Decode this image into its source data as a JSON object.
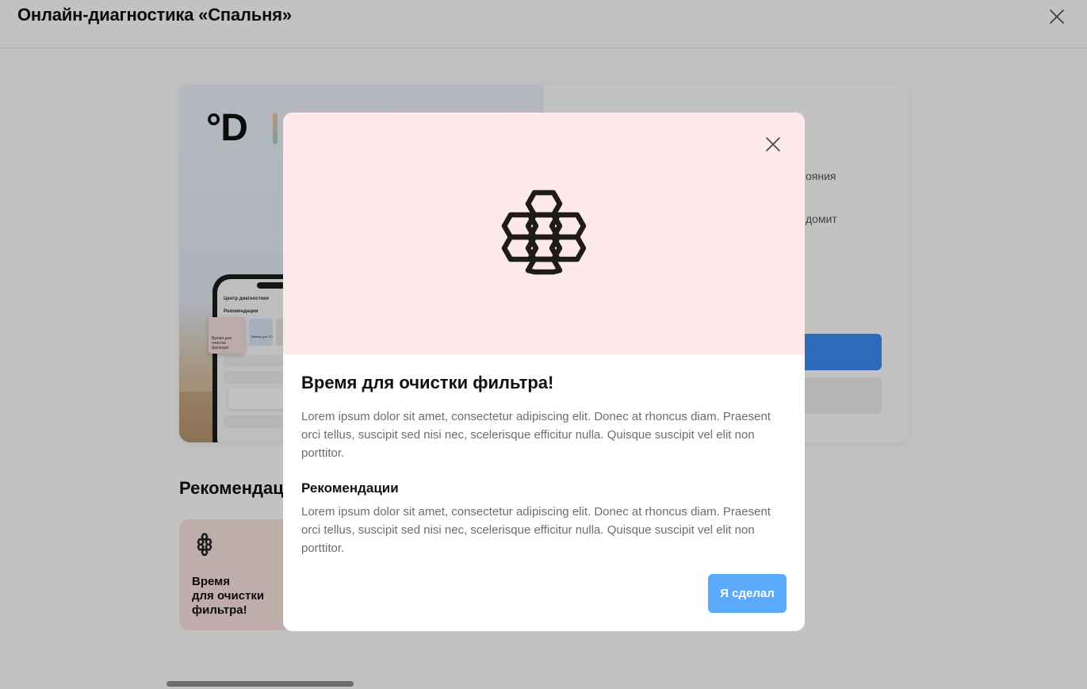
{
  "page": {
    "title": "Онлайн-диагностика «Спальня»",
    "close_icon": "close-icon",
    "brand": "°D",
    "hero_right_lines": [
      "ояния",
      "домит"
    ],
    "phone": {
      "header": "Центр диагностики",
      "section": "Рекомендации",
      "tile_label": "Время для очистки фильтра!",
      "tile2_label": "Время для ТО"
    },
    "recommendations_title": "Рекомендации",
    "rec_card": {
      "icon": "honeycomb-icon",
      "label": "Время\nдля очистки\nфильтра!"
    }
  },
  "modal": {
    "close_icon": "close-icon",
    "hero_icon": "honeycomb-icon",
    "title": "Время для очистки фильтра!",
    "description": "Lorem ipsum dolor sit amet, consectetur adipiscing elit. Donec at rhoncus diam. Praesent orci tellus, suscipit sed nisi nec, scelerisque efficitur nulla. Quisque suscipit vel elit non porttitor.",
    "recommendations_title": "Рекомендации",
    "recommendations_text": "Lorem ipsum dolor sit amet, consectetur adipiscing elit. Donec at rhoncus diam. Praesent orci tellus, suscipit sed nisi nec, scelerisque efficitur nulla. Quisque suscipit vel elit non porttitor.",
    "done_button": "Я сделал"
  },
  "colors": {
    "modal_header_bg": "#fde9e9",
    "primary_button": "#5aa9fa",
    "hero_primary_button": "#3d8cf4",
    "overlay": "rgba(0,0,0,0.24)"
  }
}
